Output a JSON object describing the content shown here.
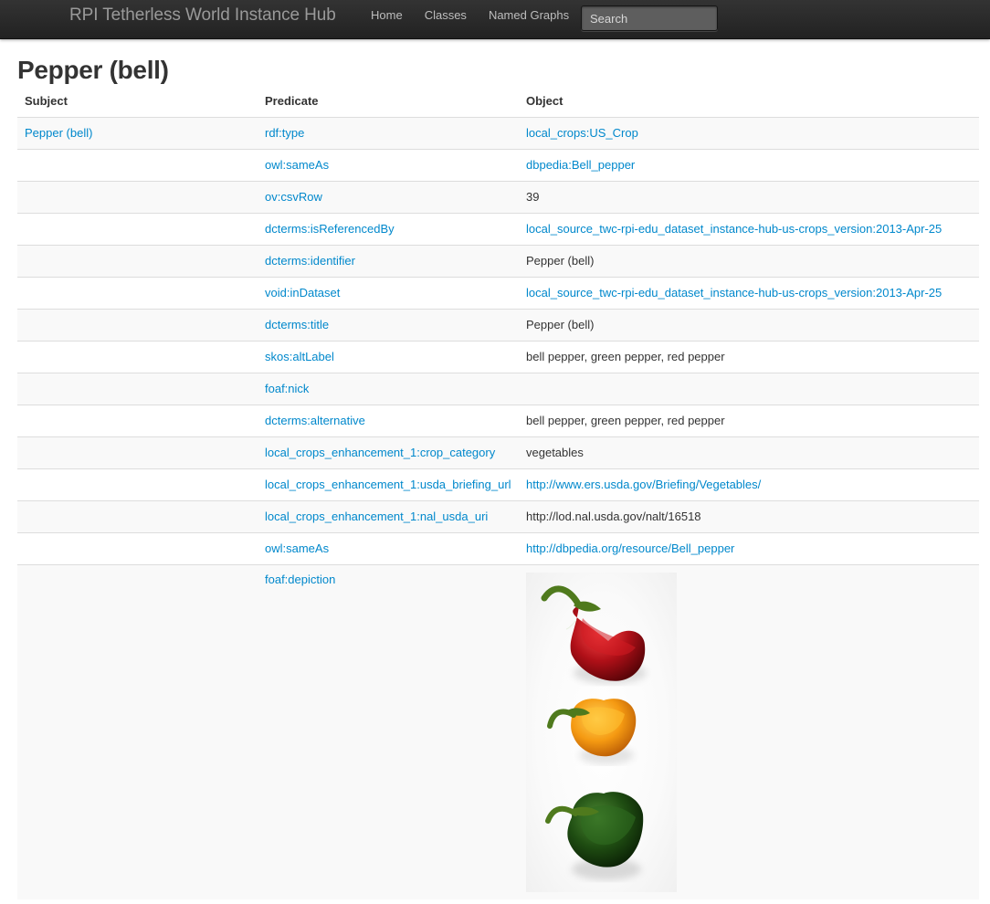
{
  "navbar": {
    "brand": "RPI Tetherless World Instance Hub",
    "links": [
      "Home",
      "Classes",
      "Named Graphs"
    ],
    "search_placeholder": "Search"
  },
  "page": {
    "title": "Pepper (bell)"
  },
  "table": {
    "headers": [
      "Subject",
      "Predicate",
      "Object"
    ],
    "rows": [
      {
        "subject": "Pepper (bell)",
        "predicate": "rdf:type",
        "object": "local_crops:US_Crop",
        "object_link": true
      },
      {
        "subject": "",
        "predicate": "owl:sameAs",
        "object": "dbpedia:Bell_pepper",
        "object_link": true
      },
      {
        "subject": "",
        "predicate": "ov:csvRow",
        "object": "39",
        "object_link": false
      },
      {
        "subject": "",
        "predicate": "dcterms:isReferencedBy",
        "object": "local_source_twc-rpi-edu_dataset_instance-hub-us-crops_version:2013-Apr-25",
        "object_link": true
      },
      {
        "subject": "",
        "predicate": "dcterms:identifier",
        "object": "Pepper (bell)",
        "object_link": false
      },
      {
        "subject": "",
        "predicate": "void:inDataset",
        "object": "local_source_twc-rpi-edu_dataset_instance-hub-us-crops_version:2013-Apr-25",
        "object_link": true
      },
      {
        "subject": "",
        "predicate": "dcterms:title",
        "object": "Pepper (bell)",
        "object_link": false
      },
      {
        "subject": "",
        "predicate": "skos:altLabel",
        "object": "bell pepper, green pepper, red pepper",
        "object_link": false
      },
      {
        "subject": "",
        "predicate": "foaf:nick",
        "object": "",
        "object_link": false
      },
      {
        "subject": "",
        "predicate": "dcterms:alternative",
        "object": "bell pepper, green pepper, red pepper",
        "object_link": false
      },
      {
        "subject": "",
        "predicate": "local_crops_enhancement_1:crop_category",
        "object": "vegetables",
        "object_link": false
      },
      {
        "subject": "",
        "predicate": "local_crops_enhancement_1:usda_briefing_url",
        "object": "http://www.ers.usda.gov/Briefing/Vegetables/",
        "object_link": true
      },
      {
        "subject": "",
        "predicate": "local_crops_enhancement_1:nal_usda_uri",
        "object": "http://lod.nal.usda.gov/nalt/16518",
        "object_link": false
      },
      {
        "subject": "",
        "predicate": "owl:sameAs",
        "object": "http://dbpedia.org/resource/Bell_pepper",
        "object_link": true
      },
      {
        "subject": "",
        "predicate": "foaf:depiction",
        "object": "",
        "object_link": false,
        "image": true
      }
    ]
  },
  "image": {
    "peppers": [
      {
        "name": "red",
        "color": "#b01018"
      },
      {
        "name": "orange",
        "color": "#f59a12"
      },
      {
        "name": "green",
        "color": "#1f4d12"
      }
    ],
    "stem_color": "#4f7a1d"
  }
}
